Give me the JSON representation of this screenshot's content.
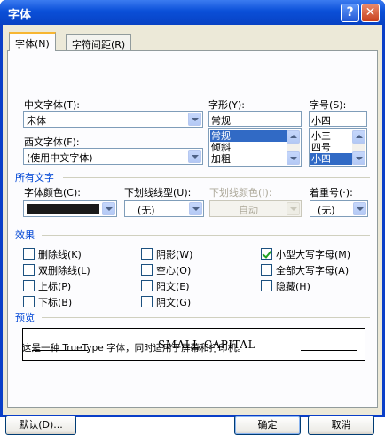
{
  "window": {
    "title": "字体",
    "help_label": "?",
    "close_label": "✕"
  },
  "tabs": [
    {
      "label": "字体(N)"
    },
    {
      "label": "字符间距(R)"
    }
  ],
  "chinese_font": {
    "label": "中文字体(T):",
    "value": "宋体"
  },
  "western_font": {
    "label": "西文字体(F):",
    "value": "(使用中文字体)"
  },
  "font_style": {
    "label": "字形(Y):",
    "value": "常规",
    "options": [
      "常规",
      "倾斜",
      "加粗"
    ],
    "selected": "常规"
  },
  "font_size": {
    "label": "字号(S):",
    "value": "小四",
    "options": [
      "小三",
      "四号",
      "小四"
    ],
    "selected": "小四"
  },
  "all_text": {
    "heading": "所有文字",
    "font_color": {
      "label": "字体颜色(C):",
      "value": "#1a1a1a"
    },
    "underline_type": {
      "label": "下划线线型(U):",
      "value": "(无)"
    },
    "underline_color": {
      "label": "下划线颜色(I):",
      "value": "自动"
    },
    "emphasis": {
      "label": "着重号(·):",
      "value": "(无)"
    }
  },
  "effects": {
    "heading": "效果",
    "items": [
      {
        "label": "删除线(K)",
        "checked": false
      },
      {
        "label": "双删除线(L)",
        "checked": false
      },
      {
        "label": "上标(P)",
        "checked": false
      },
      {
        "label": "下标(B)",
        "checked": false
      },
      {
        "label": "阴影(W)",
        "checked": false
      },
      {
        "label": "空心(O)",
        "checked": false
      },
      {
        "label": "阳文(E)",
        "checked": false
      },
      {
        "label": "阴文(G)",
        "checked": false
      },
      {
        "label": "小型大写字母(M)",
        "checked": true
      },
      {
        "label": "全部大写字母(A)",
        "checked": false
      },
      {
        "label": "隐藏(H)",
        "checked": false
      }
    ]
  },
  "preview": {
    "heading": "预览",
    "sample": "SMALL CAPITAL",
    "note": "这是一种 TrueType 字体，同时适用于屏幕和打印机。"
  },
  "buttons": {
    "default": "默认(D)...",
    "ok": "确定",
    "cancel": "取消"
  }
}
